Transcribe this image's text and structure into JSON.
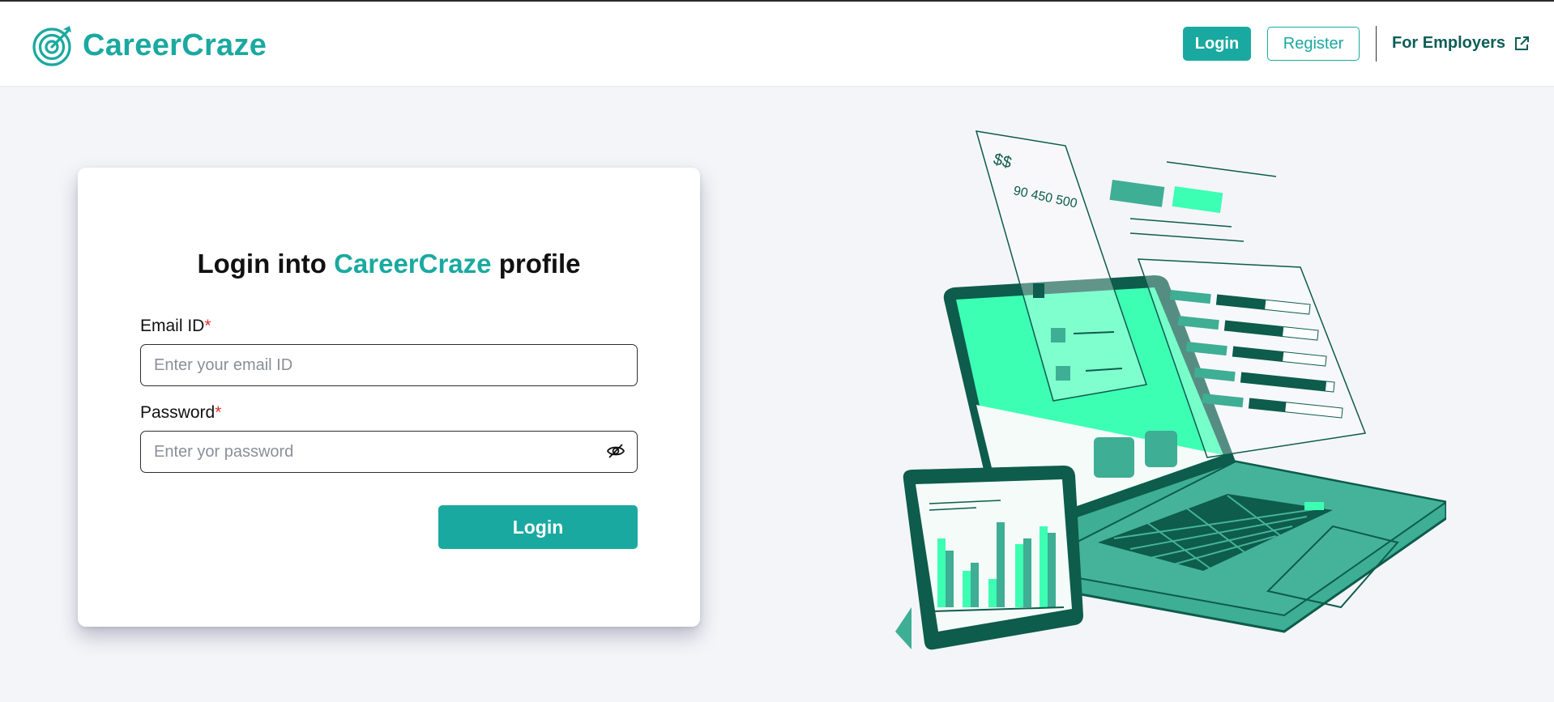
{
  "header": {
    "brand": "CareerCraze",
    "nav": {
      "login_label": "Login",
      "register_label": "Register",
      "employers_label": "For Employers"
    }
  },
  "login_card": {
    "title_prefix": "Login into ",
    "title_brand": "CareerCraze",
    "title_suffix": " profile",
    "email": {
      "label": "Email ID",
      "required_mark": "*",
      "placeholder": "Enter your email ID",
      "value": ""
    },
    "password": {
      "label": "Password",
      "required_mark": "*",
      "placeholder": "Enter yor password",
      "value": ""
    },
    "submit_label": "Login"
  },
  "illustration": {
    "currency_text": "$$",
    "numbers_text": "90 450 500"
  },
  "colors": {
    "brand": "#1aa9a0",
    "brand_dark": "#0e5e57",
    "accent_mint": "#3dffb4",
    "required": "#e03131",
    "page_bg": "#f4f5f9"
  },
  "icons": {
    "logo": "target-arrow-icon",
    "employers": "external-link-icon",
    "password_toggle": "eye-off-icon"
  }
}
